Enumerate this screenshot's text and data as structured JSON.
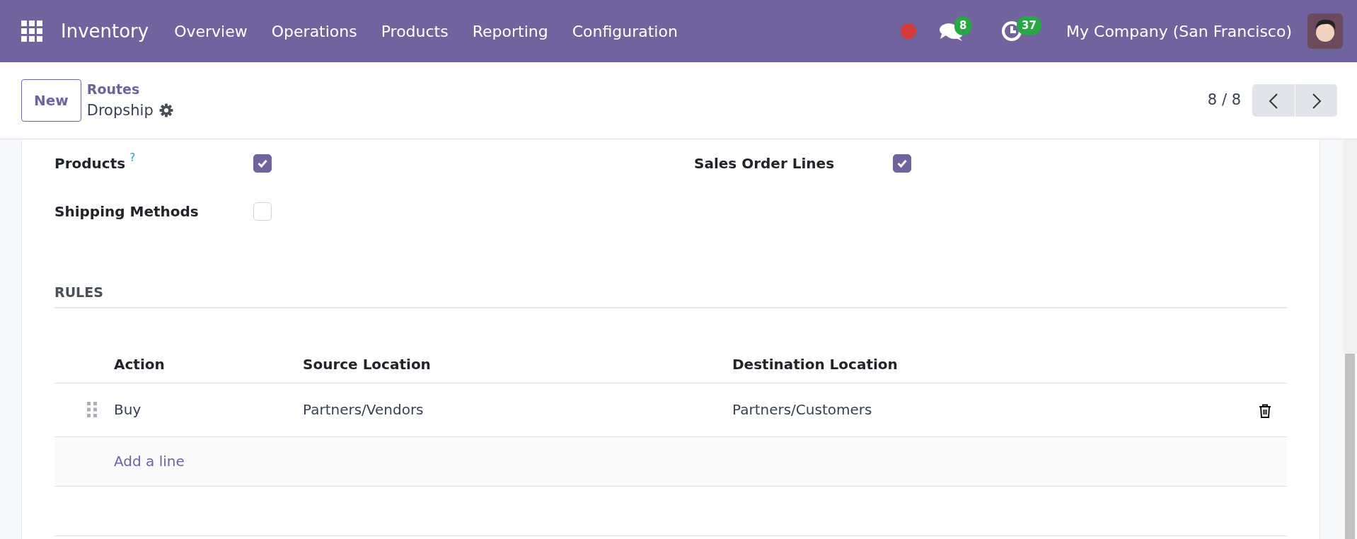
{
  "navbar": {
    "app_name": "Inventory",
    "menu": [
      "Overview",
      "Operations",
      "Products",
      "Reporting",
      "Configuration"
    ],
    "messages_badge": "8",
    "activities_badge": "37",
    "company": "My Company (San Francisco)"
  },
  "control_panel": {
    "new_button": "New",
    "breadcrumb": "Routes",
    "record_title": "Dropship",
    "pager": "8 / 8"
  },
  "fields": [
    {
      "label": "Products",
      "help": "?",
      "checked": true
    },
    {
      "label": "Sales Order Lines",
      "checked": true
    },
    {
      "label": "Shipping Methods",
      "checked": false
    }
  ],
  "rules": {
    "title": "RULES",
    "columns": [
      "Action",
      "Source Location",
      "Destination Location"
    ],
    "rows": [
      [
        "Buy",
        "Partners/Vendors",
        "Partners/Customers"
      ]
    ],
    "add_line": "Add a line"
  }
}
